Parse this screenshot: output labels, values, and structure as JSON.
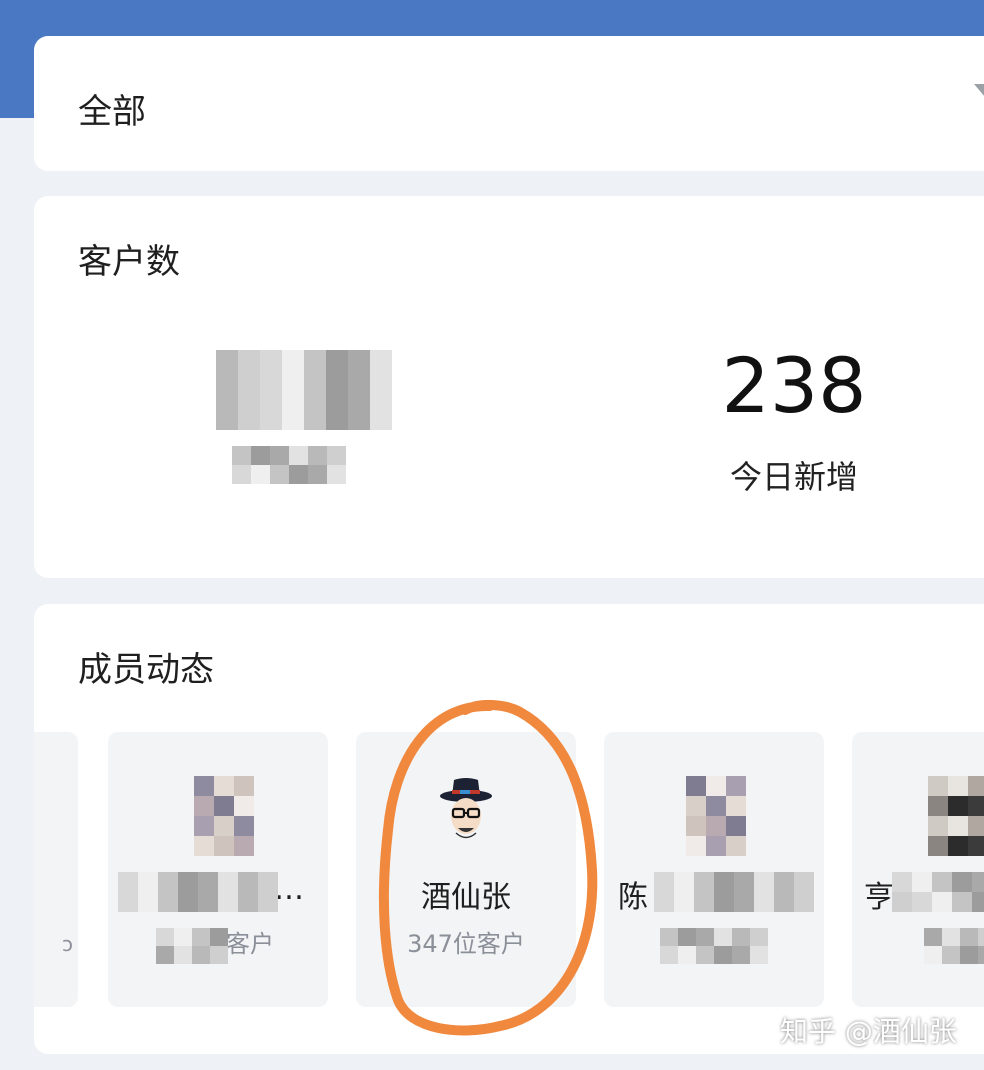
{
  "filter": {
    "selected": "全部"
  },
  "stats": {
    "title": "客户数",
    "total": {
      "value": "1",
      "label": ""
    },
    "today": {
      "value": "238",
      "label": "今日新增"
    }
  },
  "members": {
    "title": "成员动态",
    "cards": [
      {
        "name": "",
        "count": ""
      },
      {
        "name": "…",
        "count": "客户"
      },
      {
        "name": "酒仙张",
        "count": "347位客户"
      },
      {
        "name": "陈",
        "count": ""
      },
      {
        "name": "",
        "count": ""
      }
    ]
  },
  "watermark": "知乎 @酒仙张",
  "colors": {
    "header": "#4a78c2",
    "highlight": "#f0883e",
    "background": "#eef1f5"
  }
}
